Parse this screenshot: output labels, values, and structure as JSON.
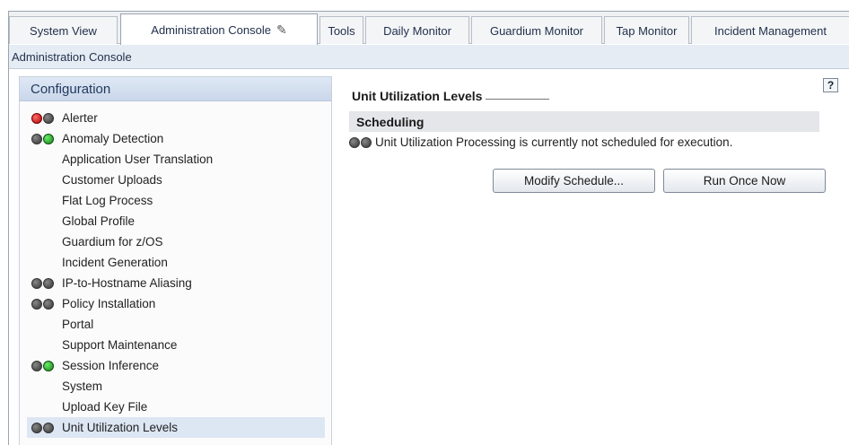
{
  "tabs": [
    {
      "label": "System View"
    },
    {
      "label": "Administration Console",
      "active": true,
      "icon": "pencil-icon"
    },
    {
      "label": "Tools"
    },
    {
      "label": "Daily Monitor"
    },
    {
      "label": "Guardium Monitor"
    },
    {
      "label": "Tap Monitor"
    },
    {
      "label": "Incident Management"
    }
  ],
  "subheader": {
    "title": "Administration Console"
  },
  "sidebar": {
    "header": "Configuration",
    "items": [
      {
        "label": "Alerter",
        "status": [
          "red",
          "gray"
        ]
      },
      {
        "label": "Anomaly Detection",
        "status": [
          "gray",
          "green"
        ]
      },
      {
        "label": "Application User Translation",
        "status": []
      },
      {
        "label": "Customer Uploads",
        "status": []
      },
      {
        "label": "Flat Log Process",
        "status": []
      },
      {
        "label": "Global Profile",
        "status": []
      },
      {
        "label": "Guardium for z/OS",
        "status": []
      },
      {
        "label": "Incident Generation",
        "status": []
      },
      {
        "label": "IP-to-Hostname Aliasing",
        "status": [
          "gray",
          "gray"
        ]
      },
      {
        "label": "Policy Installation",
        "status": [
          "gray",
          "gray"
        ]
      },
      {
        "label": "Portal",
        "status": []
      },
      {
        "label": "Support Maintenance",
        "status": []
      },
      {
        "label": "Session Inference",
        "status": [
          "gray",
          "green"
        ]
      },
      {
        "label": "System",
        "status": []
      },
      {
        "label": "Upload Key File",
        "status": []
      },
      {
        "label": "Unit Utilization Levels",
        "status": [
          "gray",
          "gray"
        ],
        "selected": true
      }
    ]
  },
  "main": {
    "help_label": "?",
    "section_title": "Unit Utilization Levels",
    "scheduling_header": "Scheduling",
    "status_text": "Unit Utilization Processing is currently not scheduled for execution.",
    "status": [
      "gray",
      "gray"
    ],
    "modify_button": "Modify Schedule...",
    "run_button": "Run Once Now"
  }
}
